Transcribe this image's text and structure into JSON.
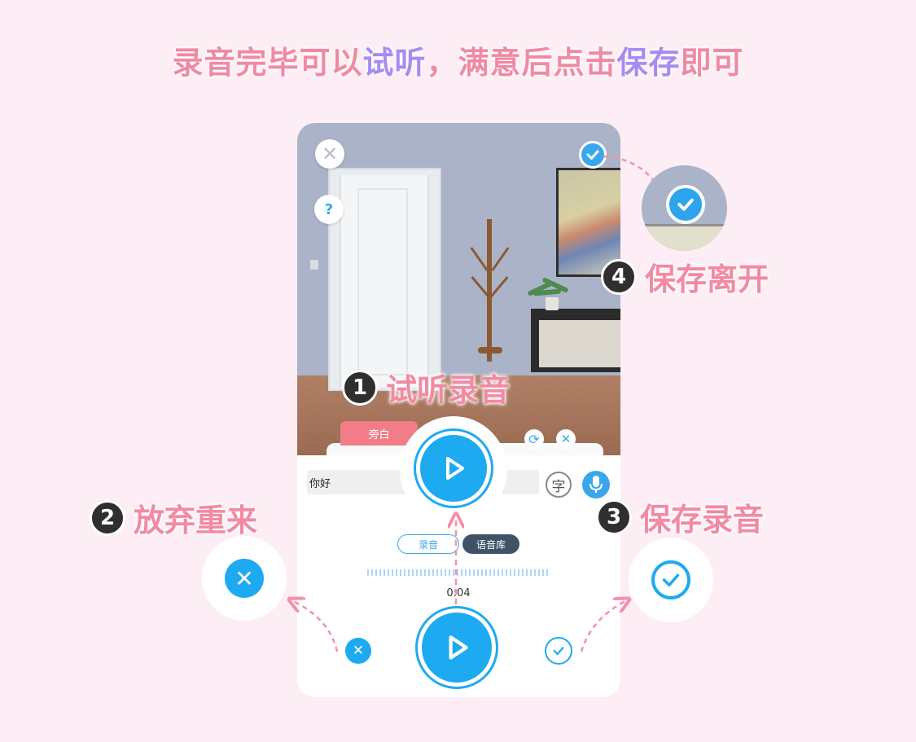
{
  "headline": {
    "part1": "录音完毕可以",
    "part2": "试听",
    "part3": "，满意后点击",
    "part4": "保存",
    "part5": "即可"
  },
  "steps": [
    {
      "num": "1",
      "label": "试听录音"
    },
    {
      "num": "2",
      "label": "放弃重来"
    },
    {
      "num": "3",
      "label": "保存录音"
    },
    {
      "num": "4",
      "label": "保存离开"
    }
  ],
  "app": {
    "help_label": "?",
    "narration_tab": "旁白",
    "text_value": "你好",
    "char_button": "字",
    "mode_tabs": [
      "录音",
      "语音库"
    ],
    "timer": "0:04"
  },
  "colors": {
    "accent": "#1eaaf1",
    "pink": "#f28aa4",
    "purple": "#a68cf2",
    "background": "#fdedf4"
  }
}
